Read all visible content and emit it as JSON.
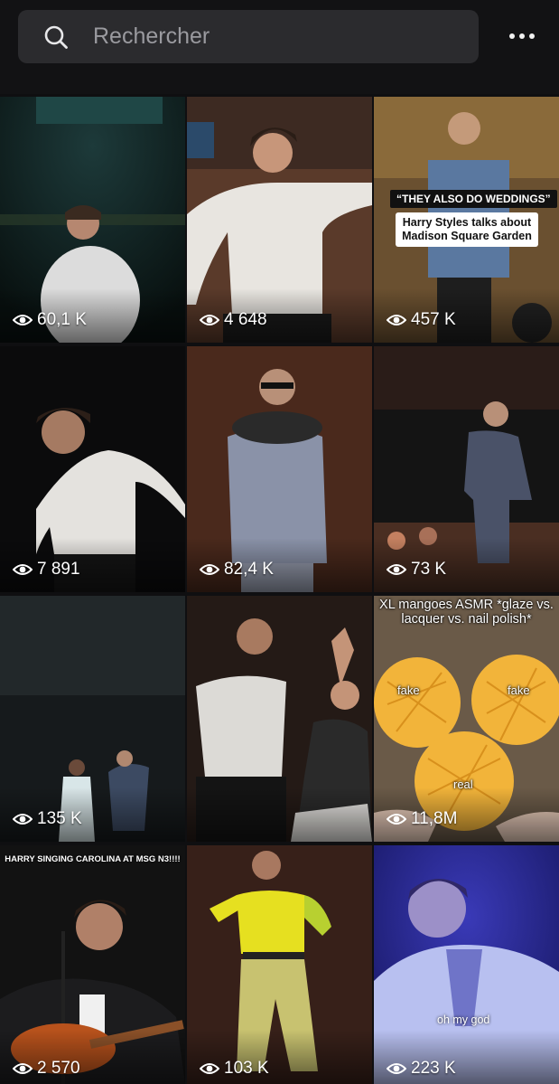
{
  "search": {
    "placeholder": "Rechercher"
  },
  "icons": {
    "search": "search-icon",
    "more": "more-horizontal-icon",
    "views": "eye-icon"
  },
  "tiles": [
    {
      "views": "60,1 K"
    },
    {
      "views": "4 648"
    },
    {
      "views": "457 K",
      "overlay_title": "“THEY ALSO DO WEDDINGS”",
      "overlay_subtitle": "Harry Styles talks about Madison Square Garden"
    },
    {
      "views": "7 891"
    },
    {
      "views": "82,4 K"
    },
    {
      "views": "73 K"
    },
    {
      "views": "135 K"
    },
    {
      "views": ""
    },
    {
      "views": "11,8M",
      "overlay_title": "XL mangoes ASMR *glaze vs. lacquer vs. nail polish*",
      "labels": [
        "fake",
        "fake",
        "real"
      ]
    },
    {
      "views": "2 570",
      "overlay_title": "HARRY SINGING CAROLINA AT MSG N3!!!!"
    },
    {
      "views": "103 K"
    },
    {
      "views": "223 K",
      "overlay_caption": "oh my god"
    }
  ]
}
